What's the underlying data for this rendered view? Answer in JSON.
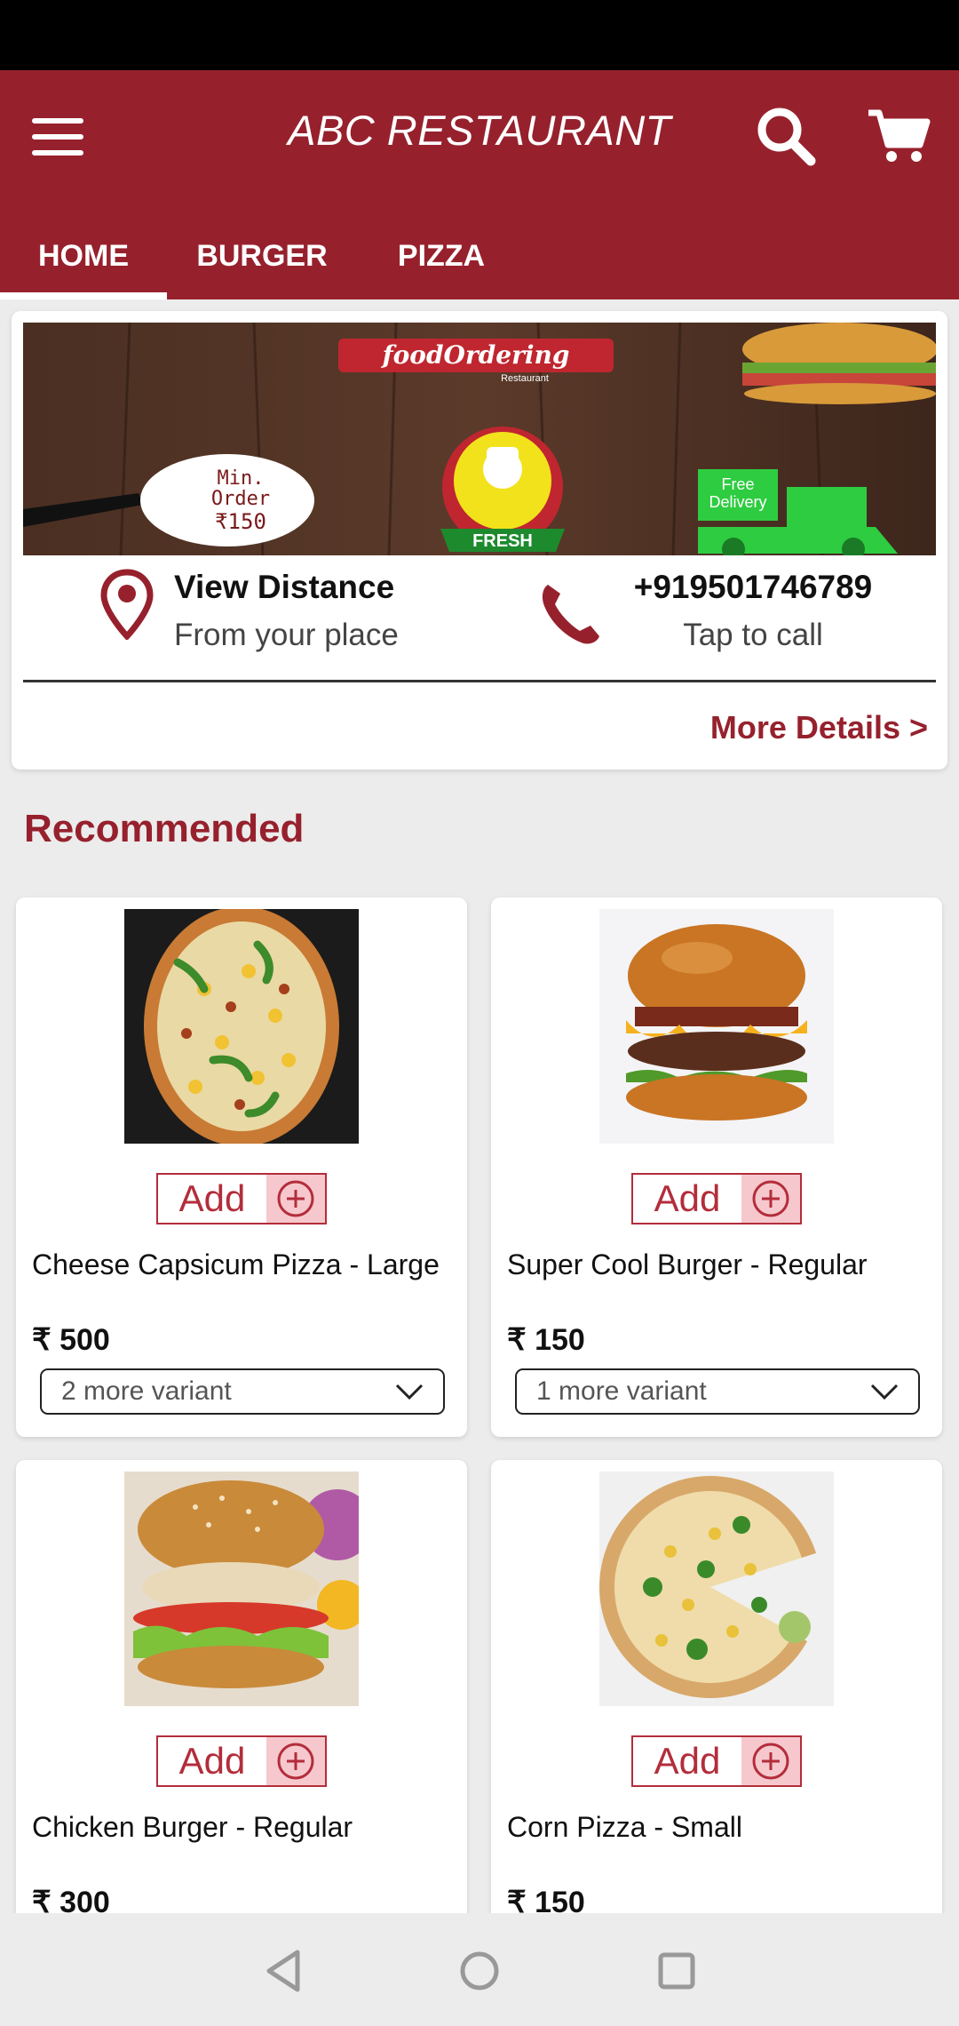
{
  "app": {
    "title": "ABC RESTAURANT",
    "theme_color": "#96212d"
  },
  "header": {
    "menu_icon": "hamburger-menu-icon",
    "search_icon": "search-icon",
    "cart_icon": "shopping-cart-icon"
  },
  "tabs": [
    {
      "label": "HOME",
      "selected": true
    },
    {
      "label": "BURGER",
      "selected": false
    },
    {
      "label": "PIZZA",
      "selected": false
    }
  ],
  "banner": {
    "logo_text": "foodOrdering",
    "logo_subtext": "Restaurant",
    "min_order_line1": "Min.",
    "min_order_line2": "Order",
    "min_order_amount": "₹150",
    "badge_label": "FRESH",
    "delivery_line1": "Free",
    "delivery_line2": "Delivery"
  },
  "info": {
    "distance_title": "View Distance",
    "distance_subtitle": "From your place",
    "phone": "+919501746789",
    "phone_subtitle": "Tap to call",
    "more_details": "More Details >"
  },
  "section": {
    "title": "Recommended"
  },
  "products": [
    {
      "name": "Cheese Capsicum Pizza - Large",
      "price": "₹ 500",
      "add_label": "Add",
      "variant": "2 more variant",
      "image": "pizza-capsicum"
    },
    {
      "name": "Super Cool Burger - Regular",
      "price": "₹ 150",
      "add_label": "Add",
      "variant": "1 more variant",
      "image": "burger-cheese"
    },
    {
      "name": "Chicken Burger - Regular",
      "price": "₹ 300",
      "add_label": "Add",
      "variant": "",
      "image": "burger-chicken"
    },
    {
      "name": "Corn Pizza - Small",
      "price": "₹ 150",
      "add_label": "Add",
      "variant": "",
      "image": "pizza-corn"
    }
  ],
  "navigation": {
    "back_icon": "back-triangle-icon",
    "home_icon": "home-circle-icon",
    "recents_icon": "recents-square-icon"
  }
}
